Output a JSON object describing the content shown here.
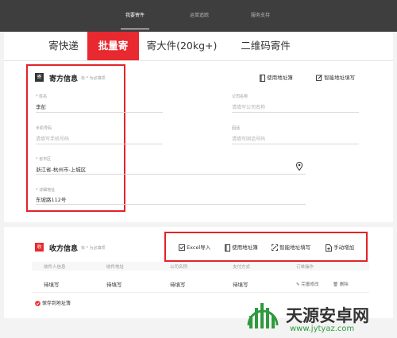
{
  "topnav": {
    "items": [
      {
        "label": "我要寄件",
        "active": true
      },
      {
        "label": "运单追踪",
        "active": false
      },
      {
        "label": "服务支持",
        "active": false
      }
    ]
  },
  "tabs": [
    {
      "label": "寄快递",
      "active": false
    },
    {
      "label": "批量寄",
      "active": true
    },
    {
      "label": "寄大件(20kg+)",
      "active": false
    },
    {
      "label": "二维码寄件",
      "active": false
    }
  ],
  "sender": {
    "badge": "寄",
    "title": "寄方信息",
    "required_note": "标 * 为必填项",
    "address_book": "使用地址簿",
    "smart_fill": "智能地址填写",
    "name": {
      "label": "* 姓名",
      "value": "李彭"
    },
    "company": {
      "label": "公司名称",
      "placeholder": "请填写公司名称"
    },
    "phone": {
      "label": "手机号码",
      "placeholder": "请填写手机号码"
    },
    "landline": {
      "label": "固话",
      "placeholder": "请填写固话号码"
    },
    "region": {
      "label": "* 省市区",
      "value": "浙江省-杭州市-上城区"
    },
    "address": {
      "label": "* 详细地址",
      "value": "东坡路112号"
    }
  },
  "receiver": {
    "badge": "收",
    "title": "收方信息",
    "required_note": "标 * 为必填项",
    "tools": {
      "excel": "Excel导入",
      "address_book": "使用地址簿",
      "smart_fill": "智能地址填写",
      "manual_add": "手动增加"
    },
    "columns": [
      "收件人信息",
      "收件地址",
      "公司名称",
      "支付方式",
      "订单操作"
    ],
    "row": {
      "info": "待填写",
      "address": "待填写",
      "company": "待填写",
      "payment": "待填写",
      "edit": "完善修改",
      "delete": "删除"
    },
    "save_to_book": "保存到地址簿"
  },
  "watermark": {
    "cn": "天源安卓网",
    "url": "www.jytyaz.com"
  },
  "colors": {
    "accent": "#e8292f",
    "topbar": "#3e3e3e",
    "highlight_box": "#e2232a",
    "watermark_green": "#2f9a3e"
  }
}
